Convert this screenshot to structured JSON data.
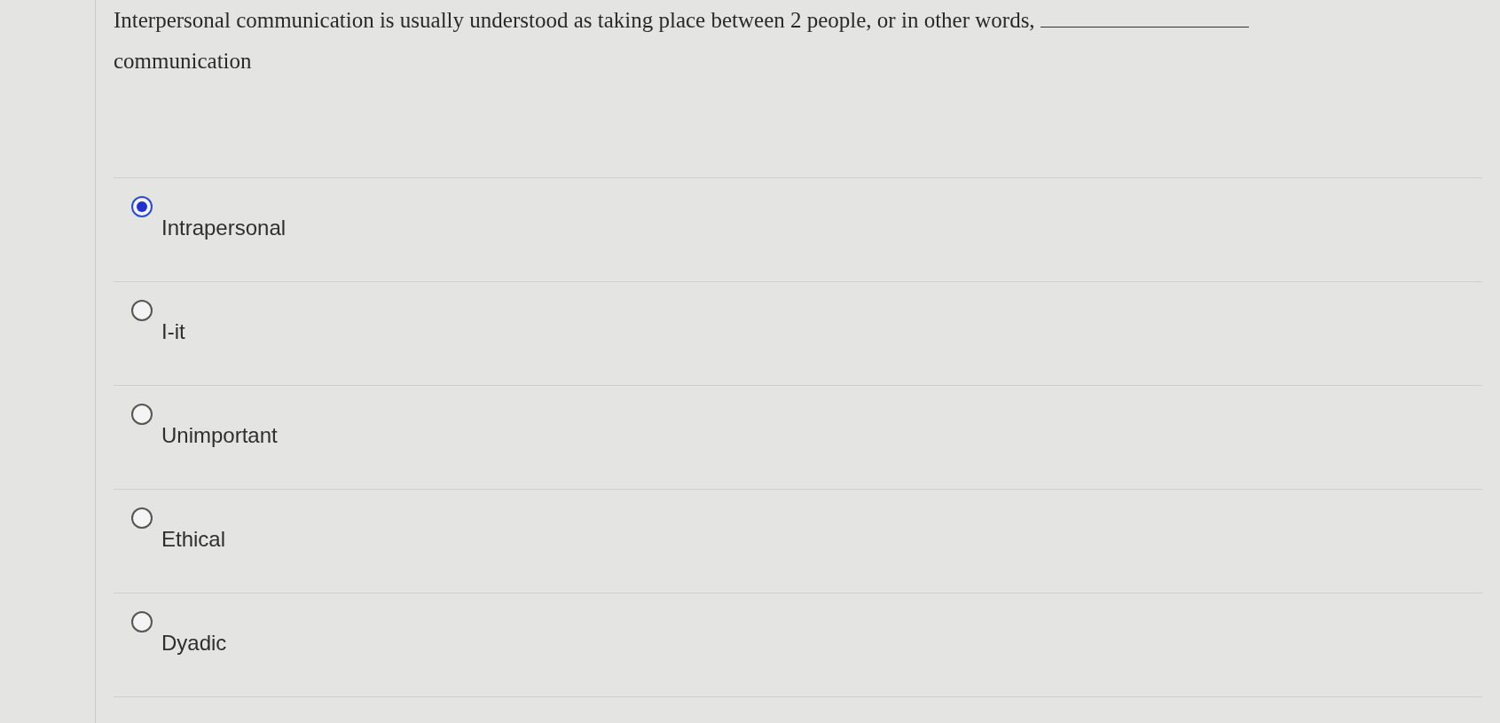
{
  "question": {
    "text": "Interpersonal communication is usually understood as taking place between 2 people, or in other words, ",
    "blank": true,
    "after": "communication"
  },
  "options": [
    {
      "label": "Intrapersonal",
      "selected": true
    },
    {
      "label": "I-it",
      "selected": false
    },
    {
      "label": "Unimportant",
      "selected": false
    },
    {
      "label": "Ethical",
      "selected": false
    },
    {
      "label": "Dyadic",
      "selected": false
    }
  ]
}
